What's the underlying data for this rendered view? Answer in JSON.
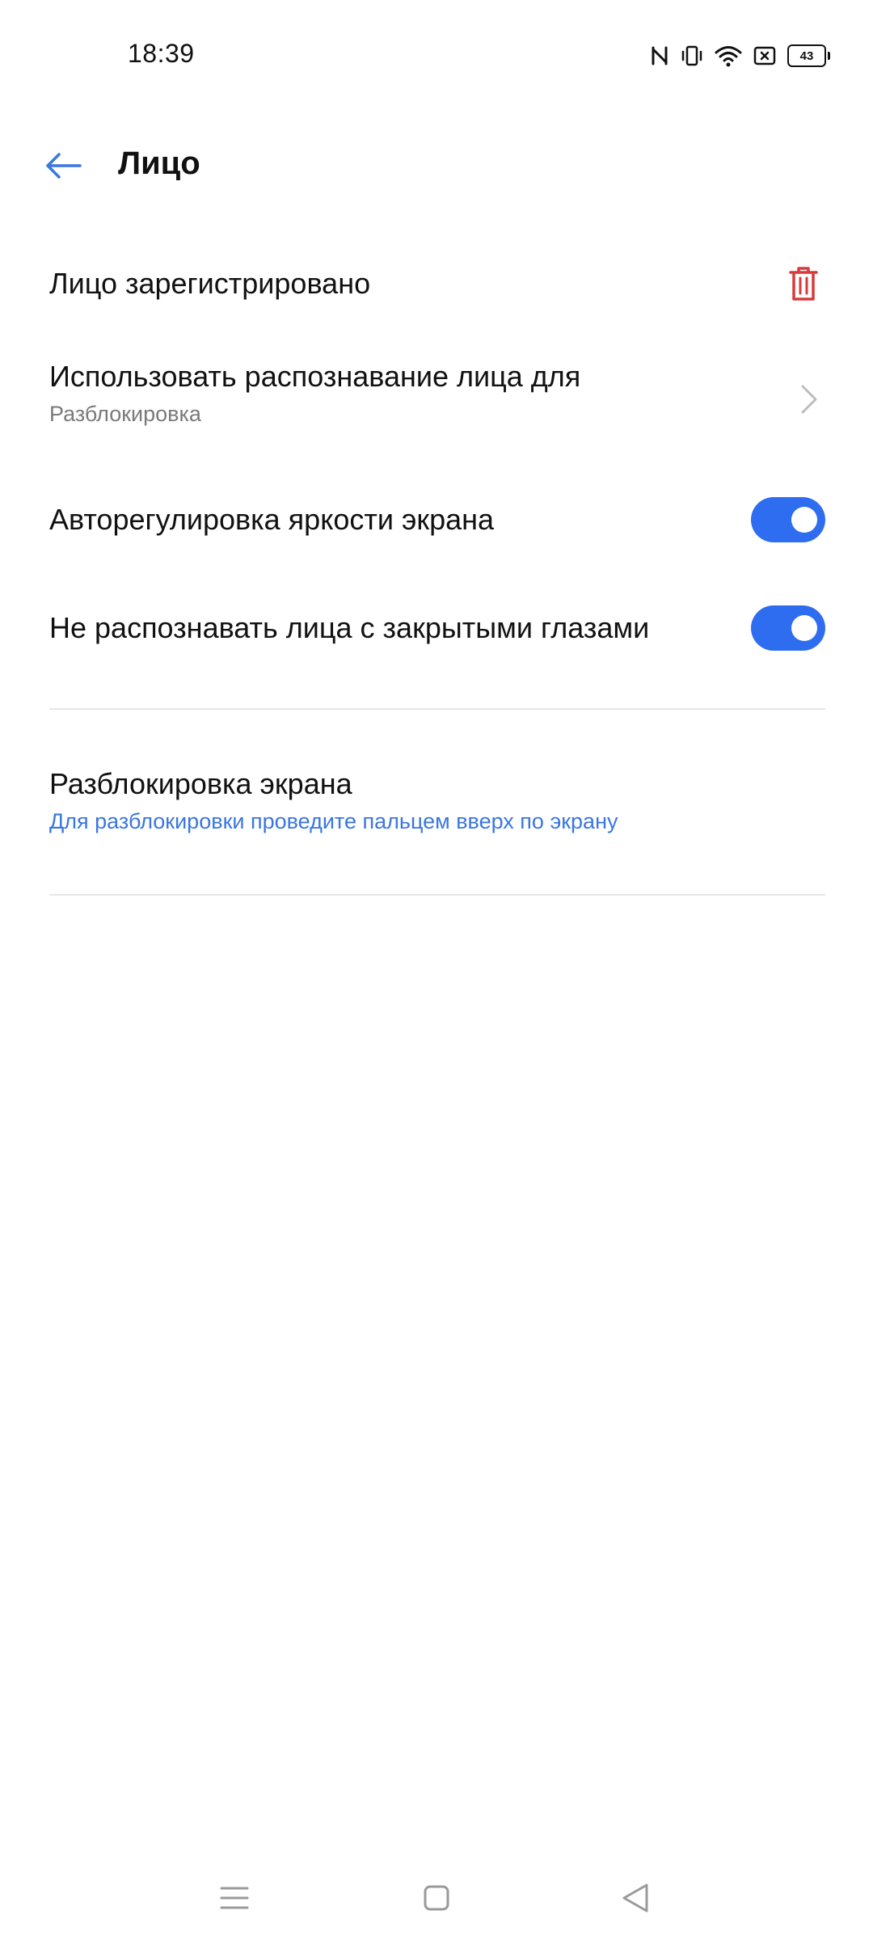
{
  "status_bar": {
    "time": "18:39",
    "icons": [
      "nfc-icon",
      "vibrate-icon",
      "wifi-icon",
      "sim-off-icon",
      "battery-icon"
    ],
    "battery_level": "43"
  },
  "header": {
    "title": "Лицо",
    "back_icon": "back-arrow-icon"
  },
  "settings": {
    "registered": {
      "title": "Лицо зарегистрировано",
      "action_icon": "trash-icon"
    },
    "use_for": {
      "title": "Использовать распознавание лица для",
      "subtitle": "Разблокировка",
      "action_icon": "chevron-right-icon"
    },
    "auto_brightness": {
      "title": "Авторегулировка яркости экрана",
      "enabled": true
    },
    "closed_eyes": {
      "title": "Не распознавать лица с закрытыми глазами",
      "enabled": true
    },
    "unlock_screen": {
      "title": "Разблокировка экрана",
      "subtitle": "Для разблокировки проведите пальцем вверх по экрану"
    }
  },
  "navbar": {
    "icons": [
      "menu-icon",
      "home-icon",
      "back-triangle-icon"
    ]
  },
  "colors": {
    "accent": "#2f6df0",
    "link": "#3a76e0",
    "danger": "#d83a3a",
    "divider": "#e6e6e6"
  }
}
